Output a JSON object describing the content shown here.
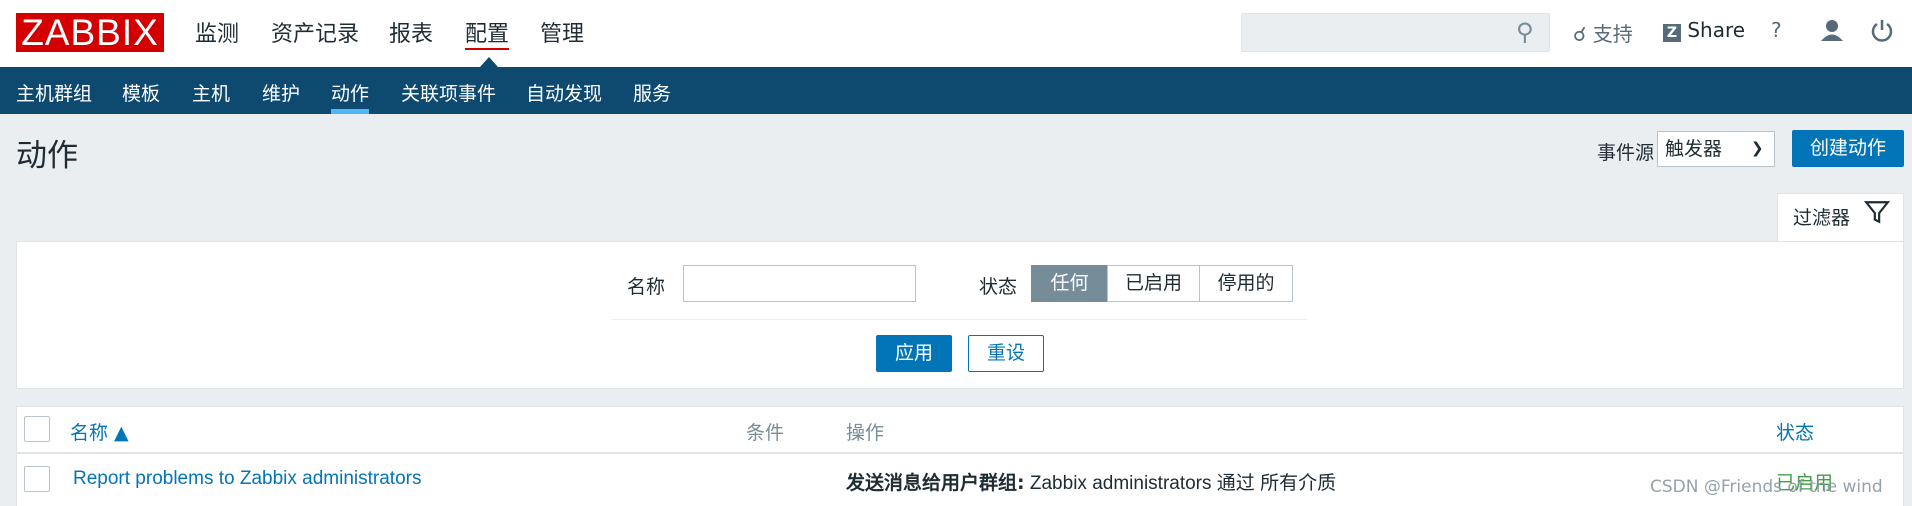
{
  "app": {
    "logo": "ZABBIX"
  },
  "main_menu": [
    {
      "label": "监测"
    },
    {
      "label": "资产记录"
    },
    {
      "label": "报表"
    },
    {
      "label": "配置"
    },
    {
      "label": "管理"
    }
  ],
  "header_tools": {
    "support": "支持",
    "share": "Share",
    "help": "?"
  },
  "sub_menu": [
    {
      "label": "主机群组"
    },
    {
      "label": "模板"
    },
    {
      "label": "主机"
    },
    {
      "label": "维护"
    },
    {
      "label": "动作"
    },
    {
      "label": "关联项事件"
    },
    {
      "label": "自动发现"
    },
    {
      "label": "服务"
    }
  ],
  "page": {
    "title": "动作",
    "event_source_label": "事件源",
    "event_source_value": "触发器",
    "create_button": "创建动作"
  },
  "filter": {
    "tab_label": "过滤器",
    "name_label": "名称",
    "name_value": "",
    "status_label": "状态",
    "status_options": [
      "任何",
      "已启用",
      "停用的"
    ],
    "status_selected": "任何",
    "apply": "应用",
    "reset": "重设"
  },
  "table": {
    "headers": {
      "name": "名称 ▲",
      "conditions": "条件",
      "operations": "操作",
      "status": "状态"
    },
    "rows": [
      {
        "name": "Report problems to Zabbix administrators",
        "operation_bold": "发送消息给用户群组:",
        "operation_text": " Zabbix administrators 通过 所有介质",
        "status": "已启用"
      }
    ]
  },
  "watermark": "CSDN @Friends of the wind",
  "colors": {
    "brand": "#d40000",
    "nav_bg": "#0e4a70",
    "primary": "#0275b8",
    "enabled": "#429e47"
  }
}
